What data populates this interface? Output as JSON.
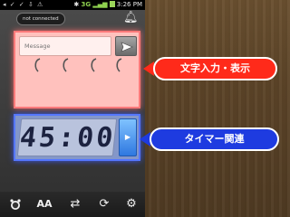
{
  "status_bar": {
    "time": "3:26",
    "ampm": "PM",
    "network": "3G"
  },
  "connection_status": "not connected",
  "message_panel": {
    "input_placeholder": "Message",
    "send_icon": "paper-plane-icon",
    "accent_color": "#ff7a7a",
    "fill_color": "#ffc1bd"
  },
  "timer_panel": {
    "display": "45:00",
    "start_icon": "play-icon",
    "accent_color": "#5577ff"
  },
  "toolbar": {
    "items": [
      {
        "icon": "alarm-clock-icon"
      },
      {
        "icon": "font-size-icon",
        "label": "AA"
      },
      {
        "icon": "swap-icon"
      },
      {
        "icon": "refresh-icon"
      },
      {
        "icon": "settings-icon"
      }
    ]
  },
  "callouts": {
    "text_input": {
      "label": "文字入力・表示",
      "color": "#ff2a1a"
    },
    "timer": {
      "label": "タイマー関連",
      "color": "#1e3be0"
    }
  }
}
